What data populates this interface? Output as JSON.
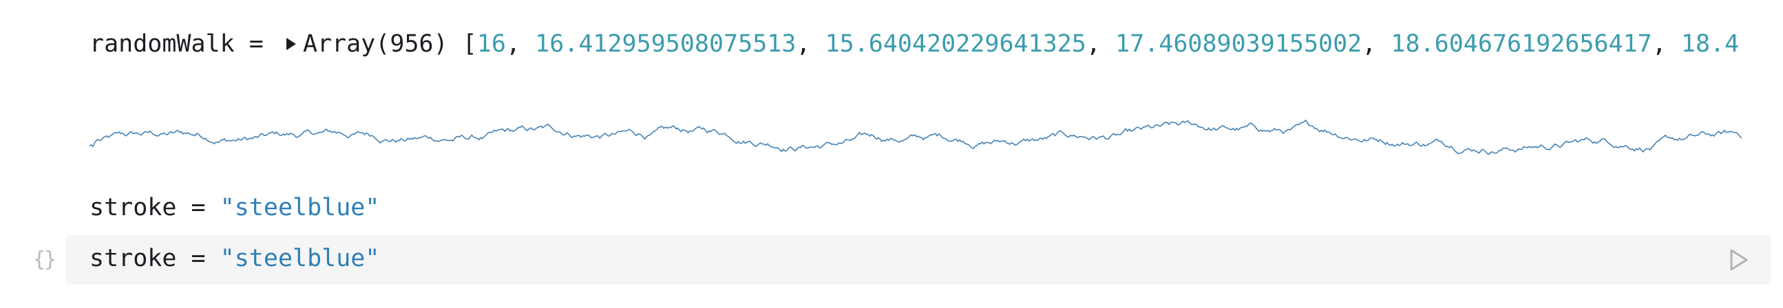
{
  "walk_cell": {
    "var_name": "randomWalk",
    "equals": " = ",
    "type_label": "Array(956)",
    "open_bracket": " [",
    "values": [
      "16",
      "16.412959508075513",
      "15.640420229641325",
      "17.46089039155002",
      "18.604676192656417",
      "18.4"
    ],
    "separator": ", "
  },
  "plot_cell": {
    "stroke_color": "#4682b4",
    "point_count": 956,
    "first_values": [
      16,
      16.412959508075513,
      15.640420229641325,
      17.46089039155002,
      18.604676192656417
    ],
    "y_domain": [
      10,
      30
    ]
  },
  "stroke_output": {
    "var_name": "stroke",
    "equals": " = ",
    "value": "\"steelblue\""
  },
  "editor": {
    "gutter_icon": "braces-icon",
    "var_name": "stroke",
    "equals": " = ",
    "value": "\"steelblue\"",
    "run_icon": "play-icon"
  }
}
